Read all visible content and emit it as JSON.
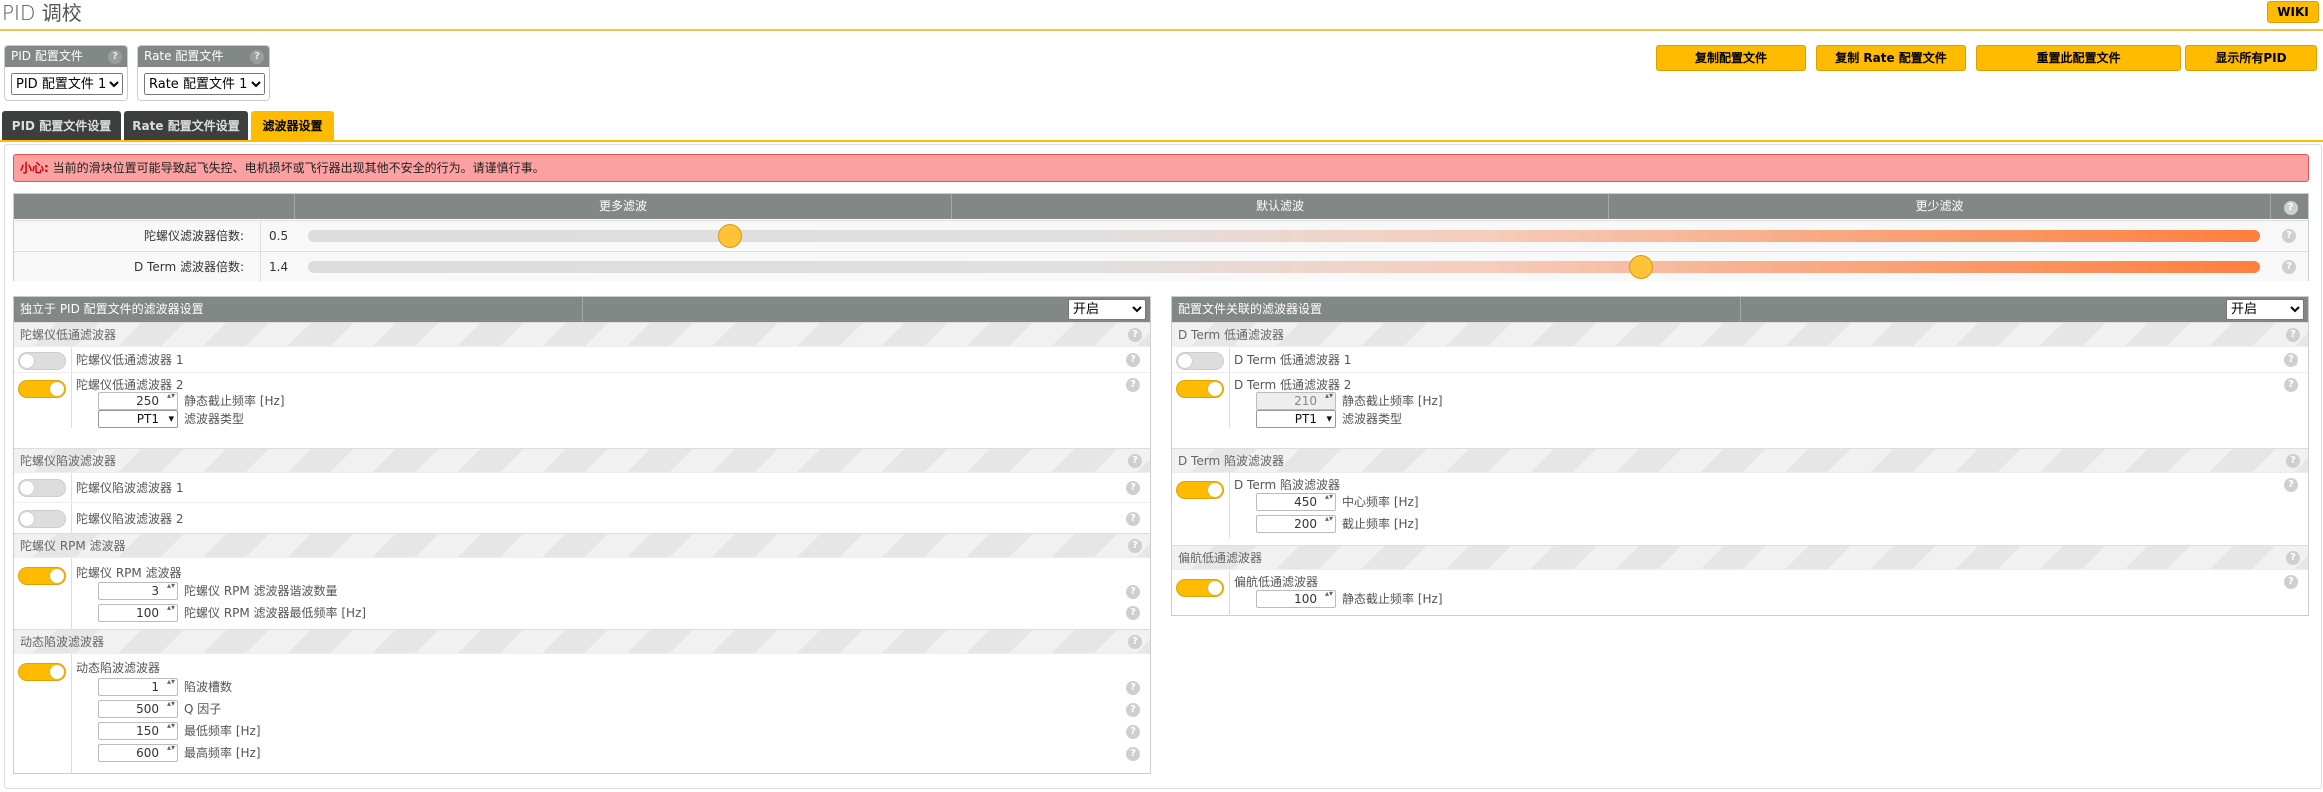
{
  "header": {
    "title": "PID 调校",
    "wiki": "WIKI"
  },
  "profiles": {
    "pid": {
      "title": "PID 配置文件",
      "selected": "PID 配置文件 1"
    },
    "rate": {
      "title": "Rate 配置文件",
      "selected": "Rate 配置文件 1"
    }
  },
  "actions": {
    "copy_profile": "复制配置文件",
    "copy_rate": "复制 Rate 配置文件",
    "reset_profile": "重置此配置文件",
    "show_all_pids": "显示所有PID"
  },
  "tabs": [
    "PID 配置文件设置",
    "Rate 配置文件设置",
    "滤波器设置"
  ],
  "warning": {
    "bold": "小心:",
    "text": " 当前的滑块位置可能导致起飞失控、电机损坏或飞行器出现其他不安全的行为。请谨慎行事。"
  },
  "slider_block": {
    "headers": [
      "更多滤波",
      "默认滤波",
      "更少滤波"
    ],
    "gyro": {
      "label": "陀螺仪滤波器倍数:",
      "value": "0.5",
      "fraction": 0.2
    },
    "dterm": {
      "label": "D Term 滤波器倍数:",
      "value": "1.4",
      "fraction": 0.71
    }
  },
  "left": {
    "title": "独立于 PID 配置文件的滤波器设置",
    "toggle_select": "开启",
    "gyro_lp": {
      "section": "陀螺仪低通滤波器",
      "lp1": "陀螺仪低通滤波器 1",
      "lp2": "陀螺仪低通滤波器 2",
      "cutoff": "250",
      "cutoff_label": "静态截止频率 [Hz]",
      "type": "PT1",
      "type_label": "滤波器类型"
    },
    "gyro_notch": {
      "section": "陀螺仪陷波滤波器",
      "n1": "陀螺仪陷波滤波器 1",
      "n2": "陀螺仪陷波滤波器 2"
    },
    "gyro_rpm": {
      "section": "陀螺仪 RPM 滤波器",
      "name": "陀螺仪 RPM 滤波器",
      "harmonics": "3",
      "harmonics_label": "陀螺仪 RPM 滤波器谐波数量",
      "min_freq": "100",
      "min_freq_label": "陀螺仪 RPM 滤波器最低频率 [Hz]"
    },
    "dyn_notch": {
      "section": "动态陷波滤波器",
      "name": "动态陷波滤波器",
      "count": "1",
      "count_label": "陷波槽数",
      "q": "500",
      "q_label": "Q 因子",
      "min": "150",
      "min_label": "最低频率 [Hz]",
      "max": "600",
      "max_label": "最高频率 [Hz]"
    }
  },
  "right": {
    "title": "配置文件关联的滤波器设置",
    "toggle_select": "开启",
    "dterm_lp": {
      "section": "D Term 低通滤波器",
      "lp1": "D Term 低通滤波器 1",
      "lp2": "D Term 低通滤波器 2",
      "cutoff": "210",
      "cutoff_label": "静态截止频率 [Hz]",
      "type": "PT1",
      "type_label": "滤波器类型"
    },
    "dterm_notch": {
      "section": "D Term 陷波滤波器",
      "name": "D Term 陷波滤波器",
      "center": "450",
      "center_label": "中心频率 [Hz]",
      "cutoff": "200",
      "cutoff_label": "截止频率 [Hz]"
    },
    "yaw_lp": {
      "section": "偏航低通滤波器",
      "name": "偏航低通滤波器",
      "cutoff": "100",
      "cutoff_label": "静态截止频率 [Hz]"
    }
  },
  "colors": {
    "accent": "#ffbb00",
    "header_gray": "#828885",
    "warning_bg": "#fca1a1"
  }
}
